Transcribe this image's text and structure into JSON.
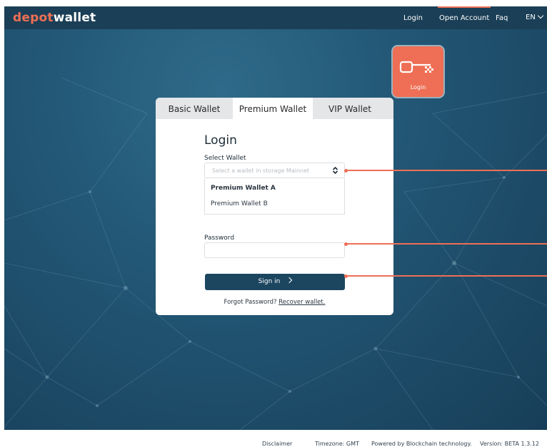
{
  "header": {
    "logo_part1": "depot",
    "logo_part2": "wallet",
    "nav": [
      "Login",
      "Open Account",
      "Faq"
    ],
    "active_nav": "Open Account",
    "language": "EN"
  },
  "badge": {
    "label": "Login",
    "icon": "key-icon"
  },
  "tabs": [
    "Basic Wallet",
    "Premium Wallet",
    "VIP Wallet"
  ],
  "active_tab": "Premium Wallet",
  "login": {
    "title": "Login",
    "select_label": "Select Wallet",
    "select_placeholder": "Select a wallet in storage Mainnet",
    "options": [
      "Premium Wallet A",
      "Premium Wallet B"
    ],
    "password_label": "Password",
    "password_value": "",
    "signin_label": "Sign in",
    "forgot_text": "Forgot Password?",
    "recover_link": "Recover wallet."
  },
  "footer": {
    "disclaimer": "Disclaimer",
    "timezone": "Timezone: GMT",
    "powered": "Powered by Blockchain technology.",
    "version": "Version: BETA 1.3.12"
  },
  "colors": {
    "accent": "#ee6f55",
    "header_bg": "#1b3f56",
    "button_bg": "#1c4660",
    "tab_bg": "#e4e6e8"
  }
}
